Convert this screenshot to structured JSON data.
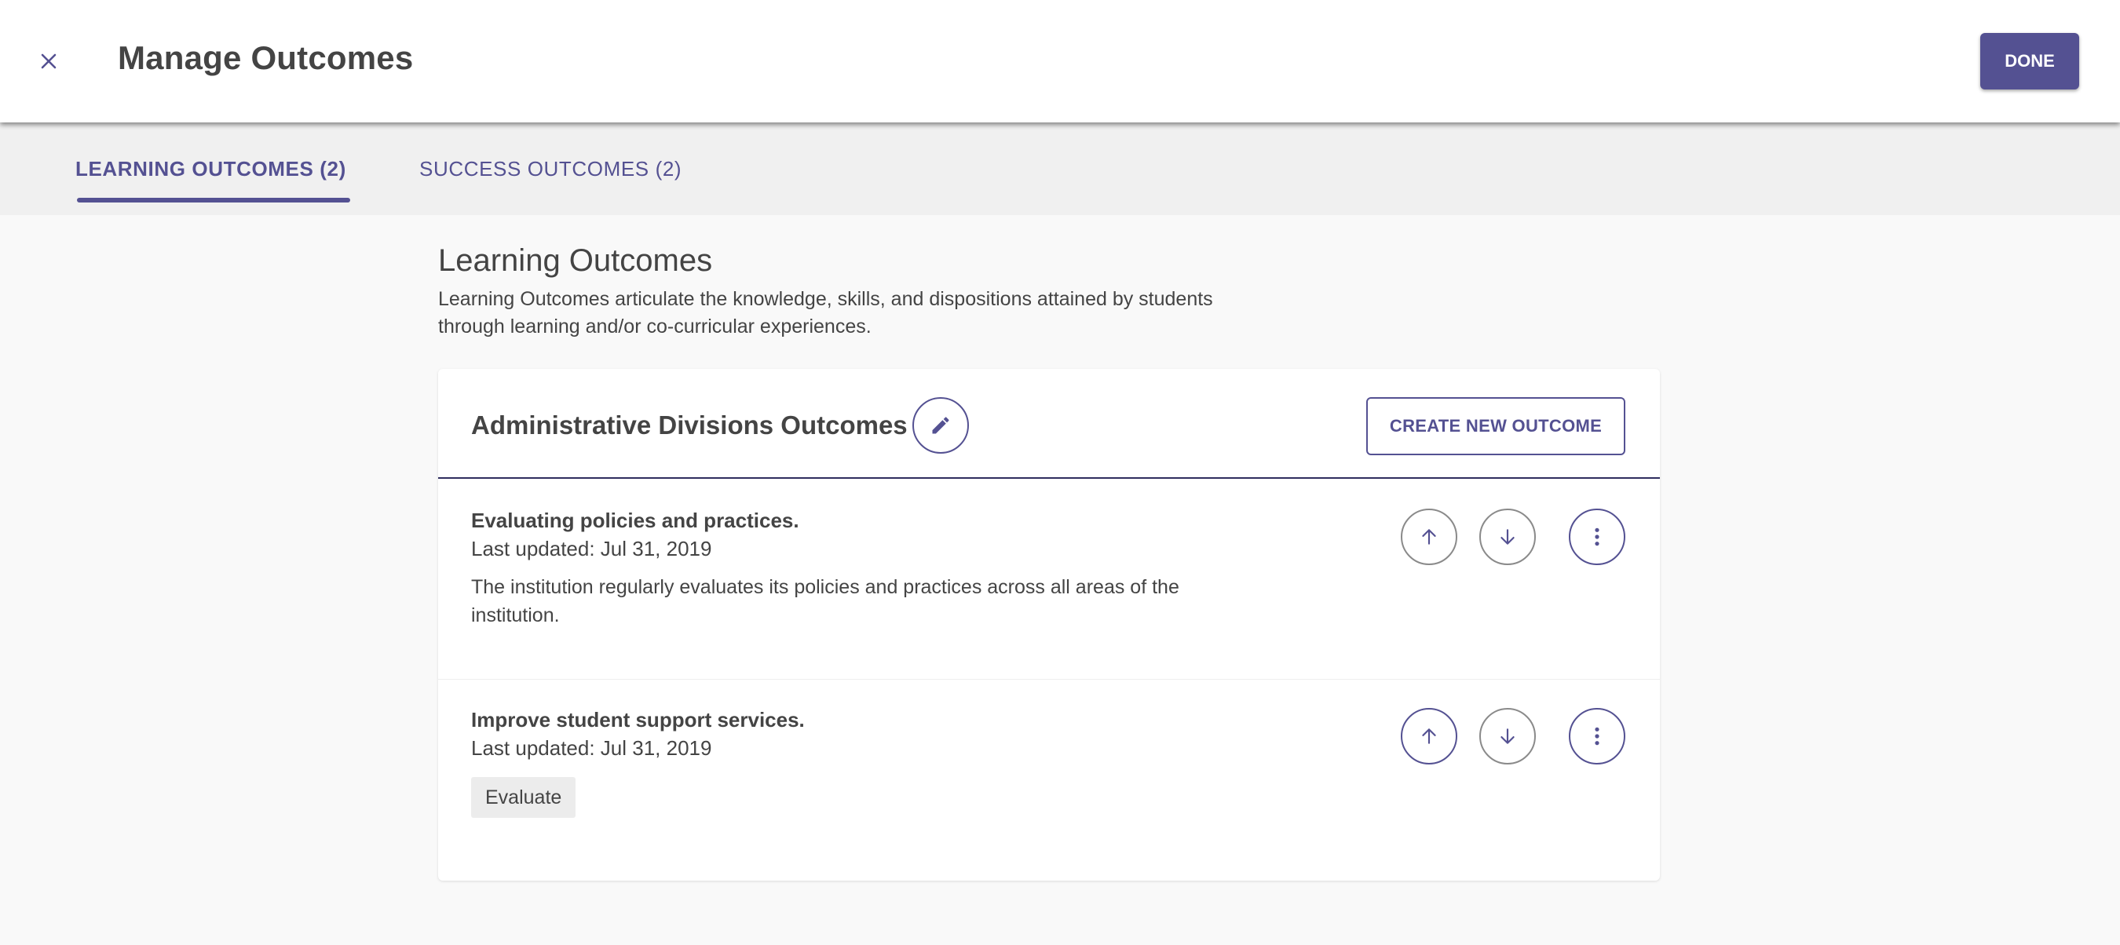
{
  "header": {
    "title": "Manage Outcomes",
    "done_label": "DONE",
    "close_icon": "close-icon"
  },
  "tabs": [
    {
      "label": "LEARNING OUTCOMES (2)",
      "active": true
    },
    {
      "label": "SUCCESS OUTCOMES (2)",
      "active": false
    }
  ],
  "section": {
    "title": "Learning Outcomes",
    "description": "Learning Outcomes articulate the knowledge, skills, and dispositions attained by students through learning and/or co-curricular experiences."
  },
  "card": {
    "title": "Administrative Divisions Outcomes",
    "create_label": "CREATE NEW OUTCOME",
    "outcomes": [
      {
        "title": "Evaluating policies and practices.",
        "updated": "Last updated: Jul 31, 2019",
        "description": "The institution regularly evaluates its policies and practices across all areas of the institution."
      },
      {
        "title": "Improve student support services.",
        "updated": "Last updated: Jul 31, 2019",
        "tag": "Evaluate"
      }
    ]
  },
  "colors": {
    "accent": "#545192",
    "accent_dark": "#2f2d5e",
    "tab_bar_bg": "#f0f0f0",
    "page_bg": "#f9f9f9"
  },
  "icons": [
    "close-icon",
    "pencil-icon",
    "arrow-up-icon",
    "arrow-down-icon",
    "more-vertical-icon"
  ]
}
